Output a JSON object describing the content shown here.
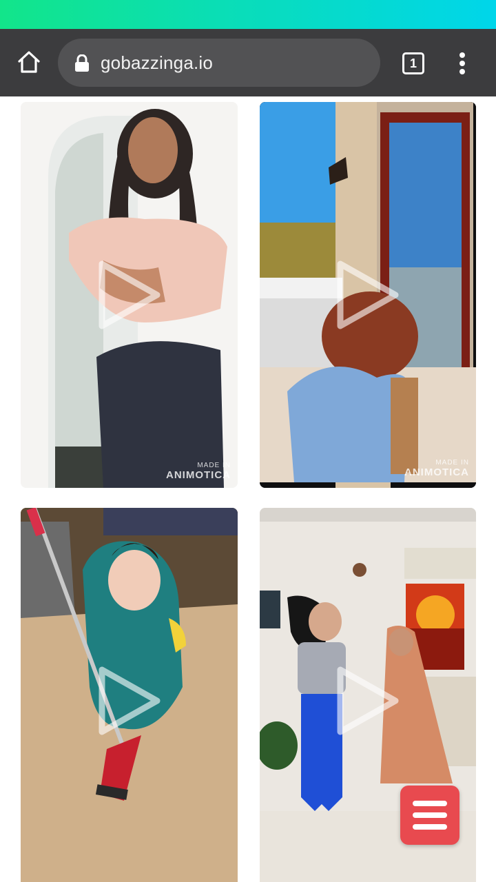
{
  "browser": {
    "url": "gobazzinga.io",
    "tab_count": "1",
    "icons": {
      "home": "home-icon",
      "lock": "lock-icon",
      "tabs": "tabs-icon",
      "menu": "more-vert-icon"
    }
  },
  "feed": {
    "videos": [
      {
        "watermark_small": "MADE IN",
        "watermark_large": "ANIMOTICA"
      },
      {
        "watermark_small": "MADE IN",
        "watermark_large": "ANIMOTICA"
      },
      {
        "watermark_small": "",
        "watermark_large": ""
      },
      {
        "watermark_small": "",
        "watermark_large": ""
      }
    ],
    "play_icon": "play-icon"
  },
  "fab": {
    "icon": "hamburger-menu-icon",
    "color": "#e84a4f"
  },
  "colors": {
    "status_bar_start": "#12e58a",
    "status_bar_end": "#00d6ea",
    "toolbar": "#3c3c3e",
    "url_bar": "#525254"
  }
}
